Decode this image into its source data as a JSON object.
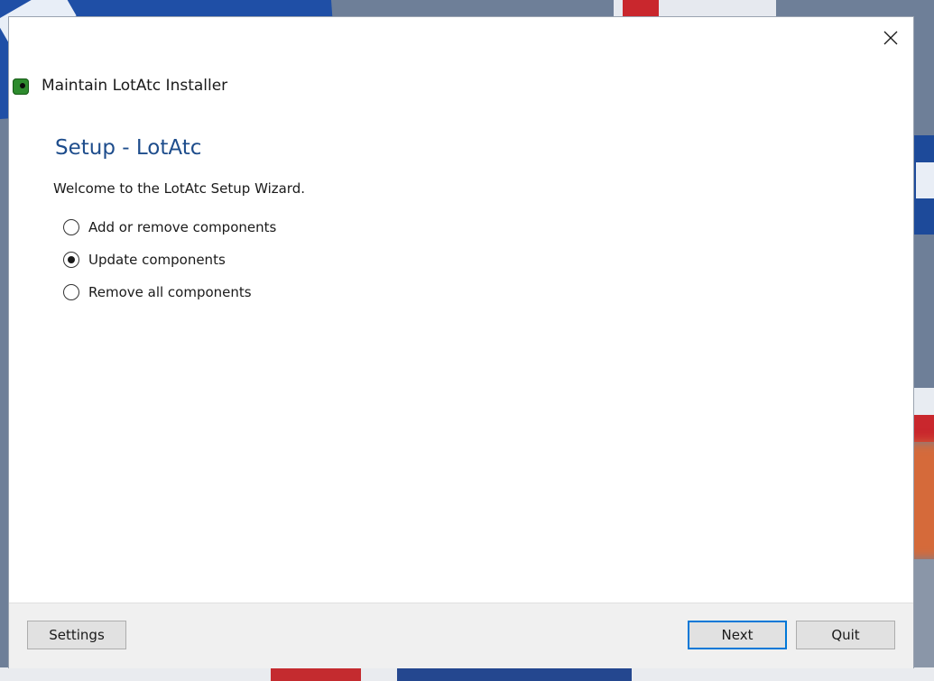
{
  "window": {
    "title": "Maintain LotAtc Installer",
    "close_icon": "close-icon"
  },
  "page": {
    "title": "Setup - LotAtc",
    "welcome": "Welcome to the LotAtc Setup Wizard."
  },
  "options": [
    {
      "label": "Add or remove components",
      "checked": false
    },
    {
      "label": "Update components",
      "checked": true
    },
    {
      "label": "Remove all components",
      "checked": false
    }
  ],
  "footer": {
    "settings_label": "Settings",
    "next_label": "Next",
    "quit_label": "Quit"
  },
  "colors": {
    "title_accent": "#1e4d8c",
    "default_button_border": "#0078d7",
    "footer_bg": "#f0f0f0"
  }
}
